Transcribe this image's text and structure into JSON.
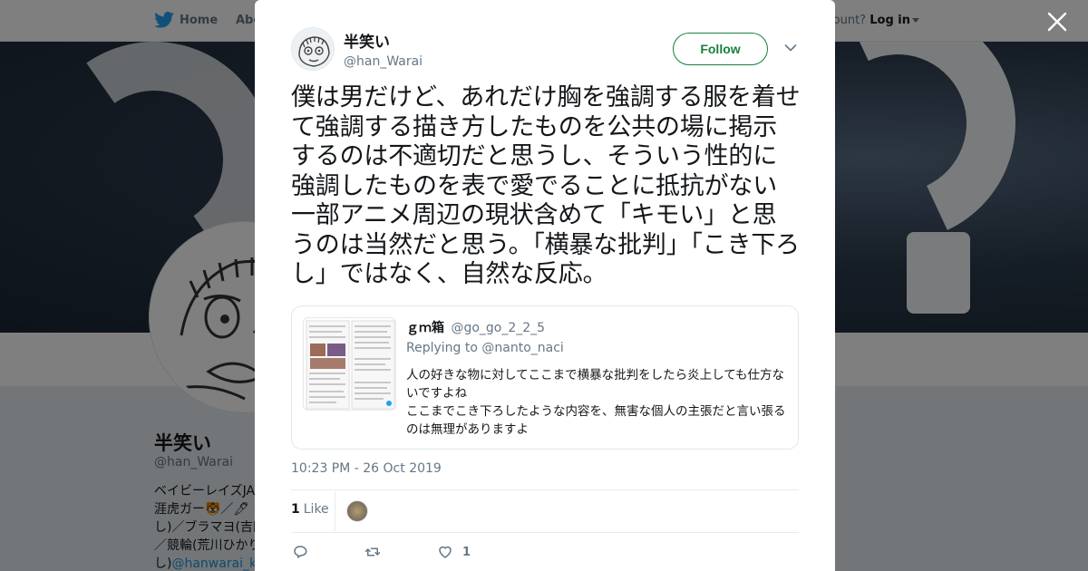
{
  "background_page": {
    "nav": {
      "home_label": "Home",
      "about_label": "Abo",
      "account_prompt": "ccount?",
      "login_label": "Log in"
    },
    "profile": {
      "name": "半笑い",
      "handle": "@han_Warai",
      "bio_lines": [
        "ベイビーレイズJA",
        "涯虎ガー🐯／🖊",
        "し)／ブラマヨ(吉田",
        "／競輪(荒川ひかり",
        "し)"
      ],
      "bio_link": "@hanwarai_ke"
    }
  },
  "modal": {
    "author": {
      "name": "半笑い",
      "handle": "@han_Warai"
    },
    "follow_label": "Follow",
    "tweet_text": "僕は男だけど、あれだけ胸を強調する服を着せて強調する描き方したものを公共の場に掲示するのは不適切だと思うし、そういう性的に強調したものを表で愛でることに抵抗がない一部アニメ周辺の現状含めて「キモい」と思うのは当然だと思う。「横暴な批判」「こき下ろし」ではなく、自然な反応。",
    "quoted_tweet": {
      "name": "ｇｍ箱",
      "handle": "@go_go_2_2_5",
      "replying_prefix": "Replying to ",
      "replying_to": "@nanto_naci",
      "body_line1": "人の好きな物に対してここまで横暴な批判をしたら炎上しても仕方ないですよね",
      "body_line2": "ここまでこき下ろしたような内容を、無害な個人の主張だと言い張るのは無理がありますよ"
    },
    "timestamp": "10:23 PM - 26 Oct 2019",
    "likes": {
      "count": "1",
      "label": "Like"
    },
    "actions": {
      "reply_icon": "reply-icon",
      "retweet_icon": "retweet-icon",
      "like_icon": "heart-icon",
      "like_count": "1"
    }
  },
  "colors": {
    "follow_green": "#17803d",
    "text_primary": "#14171a",
    "text_secondary": "#657786",
    "border": "#e1e8ed",
    "twitter_blue": "#1da1f2"
  }
}
